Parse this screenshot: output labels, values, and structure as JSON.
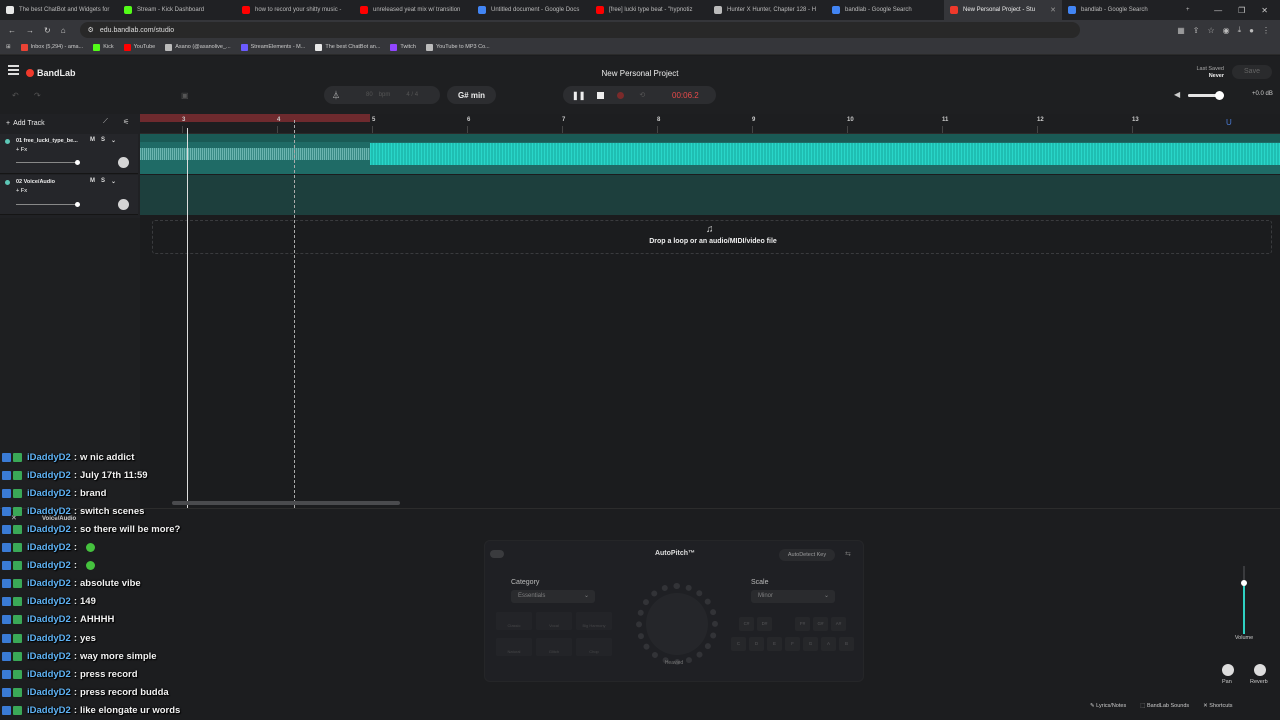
{
  "browser": {
    "tabs": [
      {
        "label": "The best ChatBot and Widgets for",
        "color": "#e8e8e8"
      },
      {
        "label": "Stream - Kick Dashboard",
        "color": "#53fc18"
      },
      {
        "label": "how to record your shitty music -",
        "color": "#ff0000"
      },
      {
        "label": "unreleased yeat mix w/ transition",
        "color": "#ff0000"
      },
      {
        "label": "Untitled document - Google Docs",
        "color": "#4285f4"
      },
      {
        "label": "[free] lucki type beat - \"hypnotiz",
        "color": "#ff0000"
      },
      {
        "label": "Hunter X Hunter, Chapter 128 - H",
        "color": "#bbbbbb"
      },
      {
        "label": "bandlab - Google Search",
        "color": "#4285f4"
      },
      {
        "label": "New Personal Project - Stu",
        "color": "#f0392b",
        "active": true
      },
      {
        "label": "bandlab - Google Search",
        "color": "#4285f4"
      }
    ],
    "url": "edu.bandlab.com/studio",
    "bookmarks": [
      {
        "label": "Inbox (5,294) - ama...",
        "color": "#ea4335"
      },
      {
        "label": "Kick",
        "color": "#53fc18"
      },
      {
        "label": "YouTube",
        "color": "#ff0000"
      },
      {
        "label": "Asano (@asanolive_...",
        "color": "#bbbbbb"
      },
      {
        "label": "StreamElements - M...",
        "color": "#6b5bff"
      },
      {
        "label": "The best ChatBot an...",
        "color": "#e8e8e8"
      },
      {
        "label": "Twitch",
        "color": "#9146ff"
      },
      {
        "label": "YouTube to MP3 Co...",
        "color": "#bbbbbb"
      }
    ]
  },
  "app": {
    "brand": "BandLab",
    "project_title": "New Personal Project",
    "last_saved_label": "Last Saved",
    "last_saved_value": "Never",
    "save_label": "Save"
  },
  "toolbar": {
    "bpm_value": "80",
    "bpm_unit": "bpm",
    "time_signature": "4 / 4",
    "key": "G# min",
    "time": "00:06.2",
    "volume_db": "+0.0 dB",
    "volume_level": 0.85
  },
  "tracks": {
    "add_label": "Add Track",
    "items": [
      {
        "number": "01",
        "name": "free_lucki_type_be...",
        "fx": "+ Fx",
        "mute": "M",
        "solo": "S"
      },
      {
        "number": "02",
        "name": "Voice/Audio",
        "fx": "+ Fx",
        "mute": "M",
        "solo": "S"
      }
    ]
  },
  "timeline": {
    "bars": [
      "3",
      "4",
      "5",
      "6",
      "7",
      "8",
      "9",
      "10",
      "11",
      "12",
      "13"
    ],
    "drop_text": "Drop a loop or an audio/MIDI/video file"
  },
  "editor": {
    "track_name": "Voice/Audio",
    "autopitch": {
      "title": "AutoPitch™",
      "autodetect": "AutoDetect Key",
      "category_label": "Category",
      "category_value": "Essentials",
      "scale_label": "Scale",
      "scale_value": "Minor",
      "knob_label": "Heavied",
      "presets": [
        "Classic",
        "Vocal",
        "Big Harmony",
        "Natural",
        "Glitch",
        "Chop"
      ],
      "notes": [
        "C",
        "D",
        "E",
        "F",
        "G",
        "A",
        "B"
      ]
    },
    "volume_label": "Volume",
    "volume_level": 0.75,
    "pan_label": "Pan",
    "reverb_label": "Reverb"
  },
  "statusbar": {
    "lyrics": "Lyrics/Notes",
    "sounds": "BandLab Sounds",
    "shortcuts": "Shortcuts"
  },
  "chat": [
    {
      "user": "iDaddyD2",
      "msg": "w nic addict"
    },
    {
      "user": "iDaddyD2",
      "msg": "July 17th 11:59"
    },
    {
      "user": "iDaddyD2",
      "msg": "brand"
    },
    {
      "user": "iDaddyD2",
      "msg": "switch scenes"
    },
    {
      "user": "iDaddyD2",
      "msg": "so there will be more?"
    },
    {
      "user": "iDaddyD2",
      "msg": "",
      "emote": true
    },
    {
      "user": "iDaddyD2",
      "msg": "",
      "emote": true
    },
    {
      "user": "iDaddyD2",
      "msg": "absolute vibe"
    },
    {
      "user": "iDaddyD2",
      "msg": "149"
    },
    {
      "user": "iDaddyD2",
      "msg": "AHHHH"
    },
    {
      "user": "iDaddyD2",
      "msg": "yes"
    },
    {
      "user": "iDaddyD2",
      "msg": "way more simple"
    },
    {
      "user": "iDaddyD2",
      "msg": "press record"
    },
    {
      "user": "iDaddyD2",
      "msg": "press record budda"
    },
    {
      "user": "iDaddyD2",
      "msg": "like elongate ur words"
    }
  ]
}
